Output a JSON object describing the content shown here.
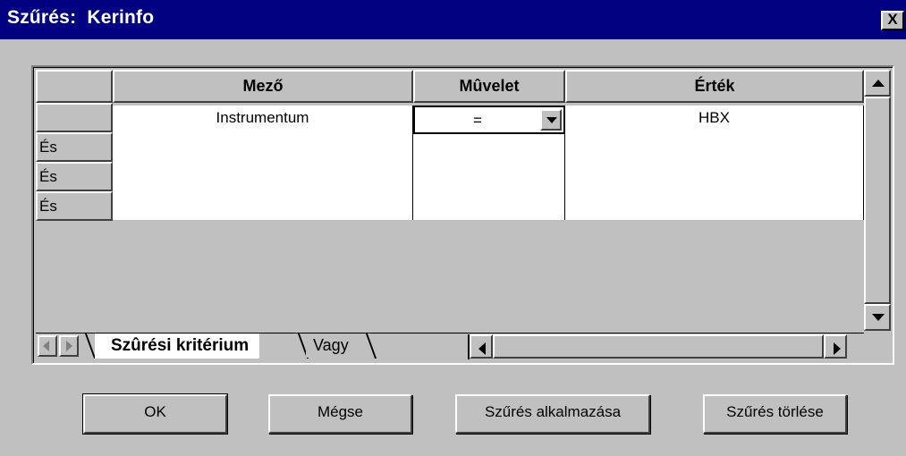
{
  "window": {
    "title": "Szűrés:  Kerinfo",
    "close_label": "X"
  },
  "grid": {
    "headers": [
      "Mező",
      "Mûvelet",
      "Érték"
    ],
    "row_headers": [
      "",
      "És",
      "És",
      "És"
    ],
    "rows": [
      {
        "field": "Instrumentum",
        "operation": "=",
        "value": "HBX"
      }
    ]
  },
  "tabs": {
    "active": "Szûrési kritérium",
    "inactive": "Vagy"
  },
  "buttons": {
    "ok": "OK",
    "cancel": "Mégse",
    "apply": "Szűrés alkalmazása",
    "clear": "Szűrés törlése"
  },
  "colors": {
    "titlebar": "#000080",
    "face": "#c0c0c0"
  }
}
